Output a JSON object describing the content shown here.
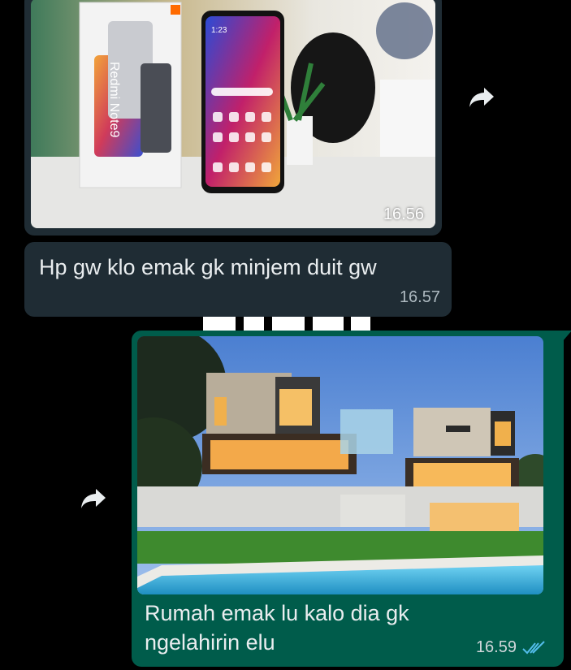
{
  "messages": [
    {
      "direction": "incoming",
      "type": "image",
      "image_description": "Redmi Note 9 phone and its box on a white table",
      "box_text": "Redmi Note9",
      "time": "16.56"
    },
    {
      "direction": "incoming",
      "type": "text",
      "text": "Hp gw klo emak gk minjem duit gw",
      "time": "16.57"
    },
    {
      "direction": "outgoing",
      "type": "image_with_caption",
      "image_description": "Modern luxury house with pool at dusk",
      "caption": "Rumah emak lu kalo dia gk ngelahirin elu",
      "time": "16.59",
      "status": "read"
    }
  ],
  "icons": {
    "forward": "forward-arrow-icon",
    "read_receipt": "double-check-icon"
  },
  "colors": {
    "background": "#000000",
    "incoming_bubble": "#1f2c34",
    "outgoing_bubble": "#005c4b",
    "read_tick": "#53bdeb"
  }
}
